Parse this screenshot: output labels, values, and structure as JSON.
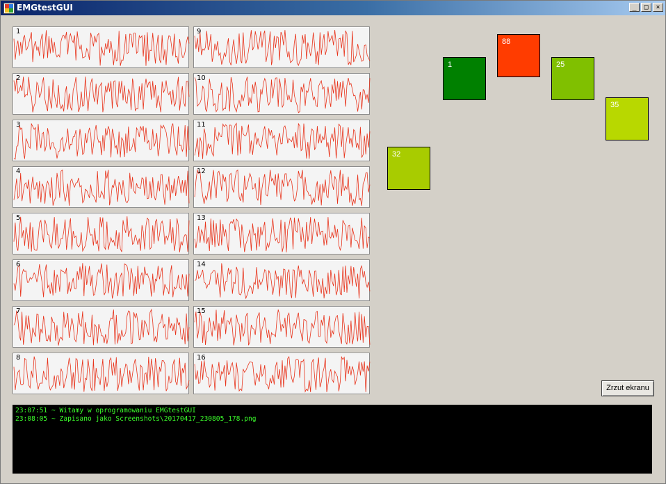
{
  "window": {
    "title": "EMGtestGUI",
    "caption_buttons": {
      "minimize": "_",
      "maximize": "□",
      "close": "×"
    }
  },
  "channels": [
    {
      "label": "1"
    },
    {
      "label": "2"
    },
    {
      "label": "3"
    },
    {
      "label": "4"
    },
    {
      "label": "5"
    },
    {
      "label": "6"
    },
    {
      "label": "7"
    },
    {
      "label": "8"
    },
    {
      "label": "9"
    },
    {
      "label": "10"
    },
    {
      "label": "11"
    },
    {
      "label": "12"
    },
    {
      "label": "13"
    },
    {
      "label": "14"
    },
    {
      "label": "15"
    },
    {
      "label": "16"
    }
  ],
  "signal_color": "#e8331b",
  "tiles": [
    {
      "value": "88",
      "color": "#ff3c00"
    },
    {
      "value": "1",
      "color": "#008000"
    },
    {
      "value": "25",
      "color": "#80c000"
    },
    {
      "value": "35",
      "color": "#b8d800"
    },
    {
      "value": "32",
      "color": "#a8cc00"
    }
  ],
  "screenshot_button": {
    "label": "Zrzut ekranu"
  },
  "console": {
    "lines": [
      "23:07:51 ~ Witamy w oprogramowaniu EMGtestGUI",
      "23:08:05 ~ Zapisano jako Screenshots\\20170417_230805_178.png"
    ]
  }
}
